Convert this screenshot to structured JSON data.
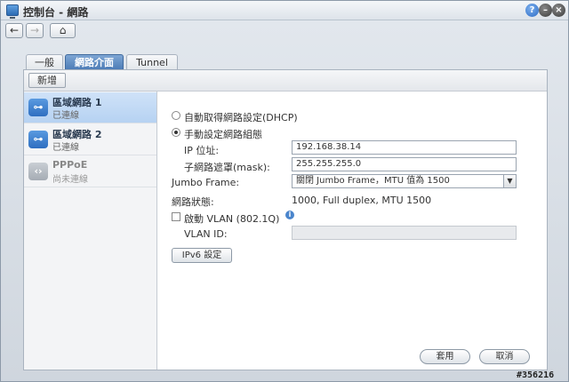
{
  "window": {
    "title": "控制台 - 網路"
  },
  "tabs": [
    "一般",
    "網路介面",
    "Tunnel"
  ],
  "toolbar": {
    "add_label": "新增"
  },
  "sidebar": {
    "items": [
      {
        "title": "區域網路 1",
        "status": "已連線",
        "icon": "network-icon",
        "selected": true
      },
      {
        "title": "區域網路 2",
        "status": "已連線",
        "icon": "network-icon",
        "selected": false
      },
      {
        "title": "PPPoE",
        "status": "尚未連線",
        "icon": "pppoe-icon",
        "selected": false
      }
    ]
  },
  "form": {
    "dhcp_label": "自動取得網路設定(DHCP)",
    "manual_label": "手動設定網路組態",
    "ip_label": "IP 位址:",
    "ip_value": "192.168.38.14",
    "mask_label": "子網路遮罩(mask):",
    "mask_value": "255.255.255.0",
    "jumbo_label": "Jumbo Frame:",
    "jumbo_value": "關閉 Jumbo Frame，MTU 值為 1500",
    "status_label": "網路狀態:",
    "status_value": "1000, Full duplex, MTU 1500",
    "vlan_label": "啟動 VLAN (802.1Q)",
    "vlan_id_label": "VLAN ID:",
    "vlan_id_value": "",
    "ipv6_label": "IPv6 設定"
  },
  "footer": {
    "apply_label": "套用",
    "cancel_label": "取消"
  },
  "watermark": "#356216",
  "colors": {
    "accent": "#4a7ab5",
    "selected_row": "#c4dbf5"
  }
}
